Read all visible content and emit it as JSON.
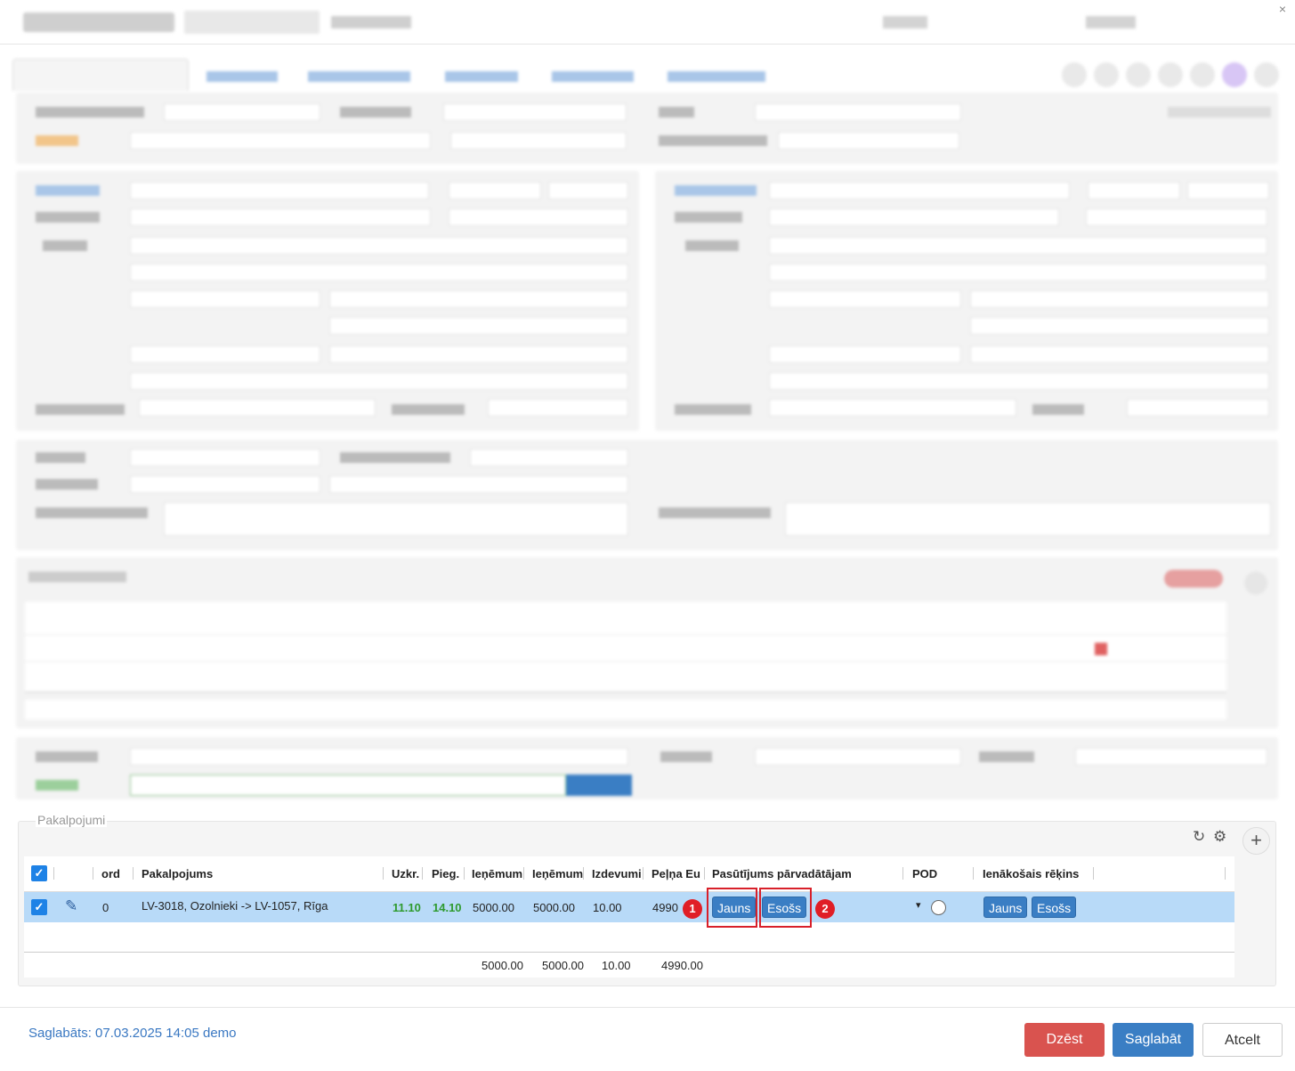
{
  "services": {
    "legend": "Pakalpojumi",
    "columns": [
      "ord",
      "Pakalpojums",
      "Uzkr.",
      "Pieg.",
      "Ieņēmum",
      "Ieņēmum",
      "Izdevumi",
      "Peļņa Eu",
      "Pasūtījums pārvadātājam",
      "POD",
      "Ienākošais rēķins"
    ],
    "row": {
      "ord": "0",
      "service": "LV-3018, Ozolnieki -> LV-1057, Rīga",
      "uzkr": "11.10",
      "pieg": "14.10",
      "income1": "5000.00",
      "income2": "5000.00",
      "expenses": "10.00",
      "profit": "4990",
      "carrier_new": "Jauns",
      "carrier_existing": "Esošs",
      "invoice_new": "Jauns",
      "invoice_existing": "Esošs"
    },
    "totals": {
      "income1": "5000.00",
      "income2": "5000.00",
      "expenses": "10.00",
      "profit": "4990.00"
    },
    "badges": [
      "1",
      "2"
    ]
  },
  "footer": {
    "saved": "Saglabāts: 07.03.2025 14:05 demo",
    "delete": "Dzēst",
    "save": "Saglabāt",
    "cancel": "Atcelt"
  },
  "icons": {
    "close": "×",
    "refresh": "↻",
    "gear": "⚙",
    "plus": "+",
    "pencil": "✎",
    "check": "✓",
    "caret": "▾"
  },
  "colors": {
    "accent": "#3a7ec4",
    "selected_row": "#b8daf8",
    "delete": "#d9534f",
    "highlight": "#d8202a",
    "date_green": "#2e9a2e"
  }
}
